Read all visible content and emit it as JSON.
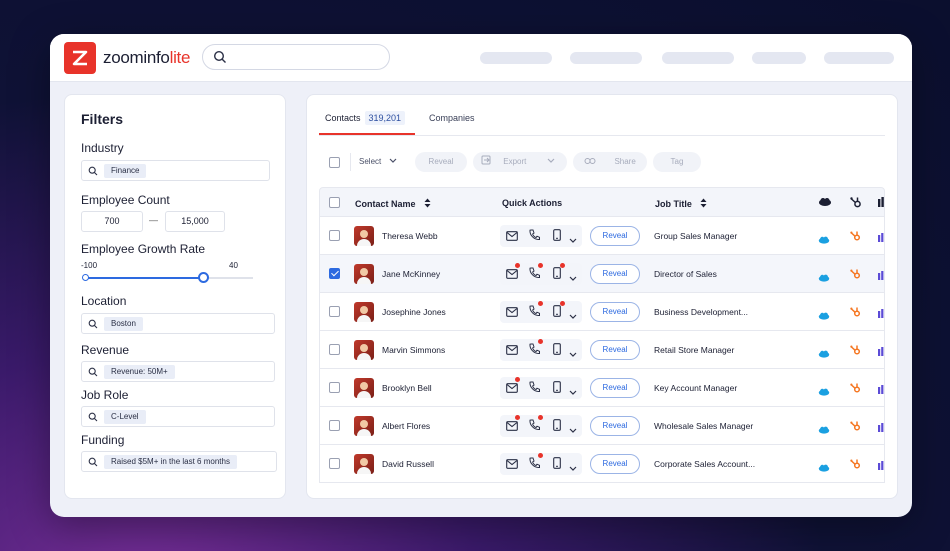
{
  "brand": {
    "name": "zoominfo",
    "suffix": "lite",
    "accent": "#e8332a"
  },
  "search": {
    "placeholder": ""
  },
  "filters": {
    "title": "Filters",
    "industry": {
      "label": "Industry",
      "chip": "Finance"
    },
    "employee_count": {
      "label": "Employee Count",
      "min": "700",
      "max": "15,000",
      "sep": "—"
    },
    "growth_rate": {
      "label": "Employee Growth Rate",
      "min_label": "-100",
      "max_label": "40",
      "fill_fraction": 0.7
    },
    "location": {
      "label": "Location",
      "chip": "Boston"
    },
    "revenue": {
      "label": "Revenue",
      "chip": "Revenue: 50M+"
    },
    "job_role": {
      "label": "Job Role",
      "chip": "C-Level"
    },
    "funding": {
      "label": "Funding",
      "chip": "Raised $5M+ in the last 6 months"
    }
  },
  "tabs": [
    {
      "label": "Contacts",
      "count": "319,201",
      "active": true
    },
    {
      "label": "Companies",
      "count": "",
      "active": false
    }
  ],
  "toolbar": {
    "select": "Select",
    "reveal": "Reveal",
    "export": "Export",
    "share": "Share",
    "tag": "Tag"
  },
  "table": {
    "headers": {
      "name": "Contact Name",
      "actions": "Quick Actions",
      "job": "Job Title"
    },
    "reveal_label": "Reveal",
    "rows": [
      {
        "name": "Theresa Webb",
        "job": "Group Sales Manager",
        "checked": false
      },
      {
        "name": "Jane McKinney",
        "job": "Director of Sales",
        "checked": true
      },
      {
        "name": "Josephine Jones",
        "job": "Business Development...",
        "checked": false
      },
      {
        "name": "Marvin Simmons",
        "job": "Retail Store Manager",
        "checked": false
      },
      {
        "name": "Brooklyn Bell",
        "job": "Key Account Manager",
        "checked": false
      },
      {
        "name": "Albert Flores",
        "job": "Wholesale Sales Manager",
        "checked": false
      },
      {
        "name": "David Russell",
        "job": "Corporate Sales Account...",
        "checked": false
      }
    ]
  }
}
